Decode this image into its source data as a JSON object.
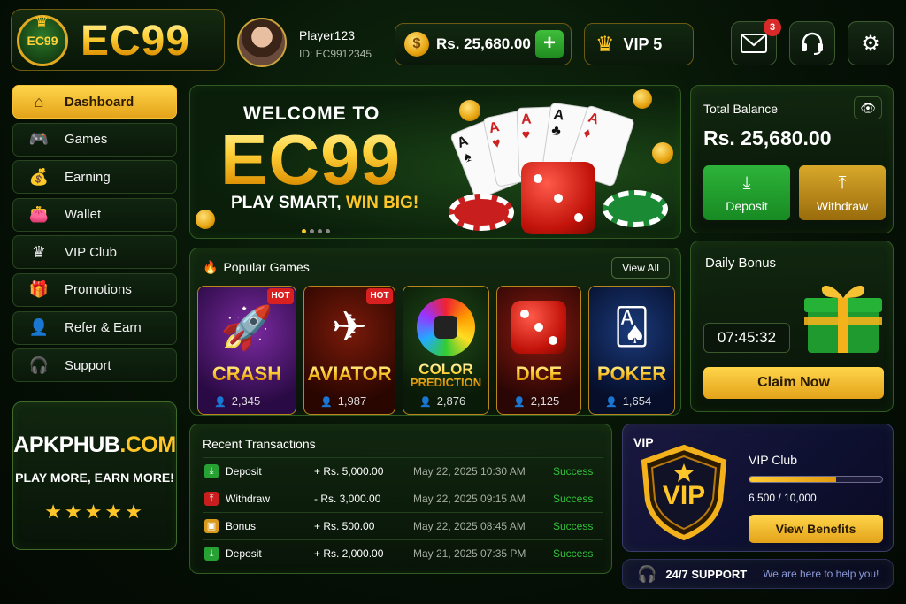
{
  "brand": {
    "logo_badge": "EC99",
    "logo_text": "EC99"
  },
  "profile": {
    "name": "Player123",
    "id": "ID: EC9912345"
  },
  "header": {
    "balance": "Rs. 25,680.00",
    "coin_symbol": "$",
    "add_symbol": "+",
    "vip_level": "VIP 5",
    "mail_badge": "3"
  },
  "sidebar": {
    "items": [
      {
        "label": "Dashboard",
        "icon": "home-icon",
        "glyph": "⌂",
        "active": true
      },
      {
        "label": "Games",
        "icon": "gamepad-icon",
        "glyph": "🎮"
      },
      {
        "label": "Earning",
        "icon": "money-bag-icon",
        "glyph": "💰"
      },
      {
        "label": "Wallet",
        "icon": "wallet-icon",
        "glyph": "👛"
      },
      {
        "label": "VIP Club",
        "icon": "crown-icon",
        "glyph": "♛"
      },
      {
        "label": "Promotions",
        "icon": "gift-icon",
        "glyph": "🎁"
      },
      {
        "label": "Refer & Earn",
        "icon": "refer-user-icon",
        "glyph": "👤"
      },
      {
        "label": "Support",
        "icon": "headset-icon",
        "glyph": "🎧"
      }
    ]
  },
  "promo": {
    "brand_main": "APKPHUB",
    "brand_accent": ".COM",
    "tagline": "PLAY MORE, EARN MORE!",
    "stars": "★★★★★"
  },
  "banner": {
    "welcome": "WELCOME TO",
    "brand": "EC99",
    "tagline_start": "PLAY SMART, ",
    "tagline_accent": "WIN BIG!"
  },
  "balance_card": {
    "label": "Total Balance",
    "value": "Rs. 25,680.00",
    "deposit_label": "Deposit",
    "withdraw_label": "Withdraw"
  },
  "bonus": {
    "title": "Daily Bonus",
    "timer": "07:45:32",
    "claim_label": "Claim Now"
  },
  "games": {
    "title": "Popular Games",
    "view_all": "View All",
    "list": [
      {
        "name": "CRASH",
        "players": "2,345",
        "hot": "HOT",
        "icon": "rocket-icon"
      },
      {
        "name": "AVIATOR",
        "players": "1,987",
        "hot": "HOT",
        "icon": "airplane-icon"
      },
      {
        "name": "COLOR PREDICTION",
        "name_top": "COLOR",
        "name_bottom": "PREDICTION",
        "players": "2,876",
        "icon": "color-wheel-icon"
      },
      {
        "name": "DICE",
        "players": "2,125",
        "icon": "dice-icon"
      },
      {
        "name": "POKER",
        "players": "1,654",
        "icon": "cards-icon"
      }
    ]
  },
  "transactions": {
    "title": "Recent Transactions",
    "rows": [
      {
        "type": "Deposit",
        "amount": "+ Rs. 5,000.00",
        "date": "May 22, 2025 10:30 AM",
        "status": "Success"
      },
      {
        "type": "Withdraw",
        "amount": "- Rs. 3,000.00",
        "date": "May 22, 2025 09:15 AM",
        "status": "Success"
      },
      {
        "type": "Bonus",
        "amount": "+ Rs. 500.00",
        "date": "May 22, 2025 08:45 AM",
        "status": "Success"
      },
      {
        "type": "Deposit",
        "amount": "+ Rs. 2,000.00",
        "date": "May 21, 2025 07:35 PM",
        "status": "Success"
      }
    ]
  },
  "vip_card": {
    "corner_label": "VIP",
    "shield_label": "VIP",
    "club_label": "VIP Club",
    "progress_text": "6,500 / 10,000",
    "progress_fraction": 0.65,
    "benefits_label": "View Benefits"
  },
  "support_bar": {
    "title": "24/7 SUPPORT",
    "subtitle": "We are here to help you!"
  },
  "colors": {
    "accent_gold": "#ffc629",
    "success_green": "#31c13a",
    "hot_red": "#d82020"
  }
}
